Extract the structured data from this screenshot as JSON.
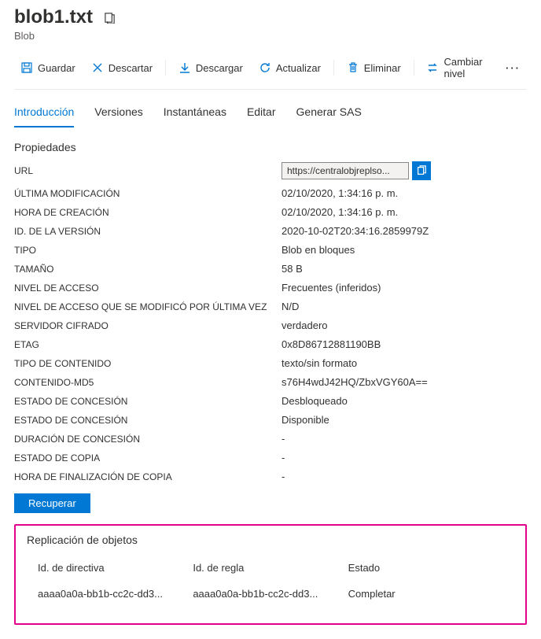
{
  "header": {
    "title": "blob1.txt",
    "subtitle": "Blob"
  },
  "toolbar": {
    "save": "Guardar",
    "discard": "Descartar",
    "download": "Descargar",
    "refresh": "Actualizar",
    "delete": "Eliminar",
    "change_tier": "Cambiar nivel"
  },
  "tabs": {
    "overview": "Introducción",
    "versions": "Versiones",
    "snapshots": "Instantáneas",
    "edit": "Editar",
    "generate_sas": "Generar SAS"
  },
  "section": {
    "properties": "Propiedades"
  },
  "props": {
    "url_label": "URL",
    "url_value": "https://centralobjreplso...",
    "last_modified_label": "ÚLTIMA MODIFICACIÓN",
    "last_modified_value": "02/10/2020, 1:34:16 p. m.",
    "created_label": "HORA DE CREACIÓN",
    "created_value": "02/10/2020, 1:34:16 p. m.",
    "version_id_label": "ID. DE LA VERSIÓN",
    "version_id_value": "2020-10-02T20:34:16.2859979Z",
    "type_label": "TIPO",
    "type_value": "Blob en bloques",
    "size_label": "TAMAÑO",
    "size_value": "58 B",
    "access_tier_label": "NIVEL DE ACCESO",
    "access_tier_value": "Frecuentes (inferidos)",
    "access_tier_modified_label": "NIVEL DE ACCESO QUE SE MODIFICÓ POR ÚLTIMA VEZ",
    "access_tier_modified_value": "N/D",
    "encrypted_label": "SERVIDOR CIFRADO",
    "encrypted_value": "verdadero",
    "etag_label": "ETAG",
    "etag_value": "0x8D86712881190BB",
    "content_type_label": "TIPO DE CONTENIDO",
    "content_type_value": "texto/sin formato",
    "md5_label": "CONTENIDO-MD5",
    "md5_value": "s76H4wdJ42HQ/ZbxVGY60A==",
    "lease_status_label": "ESTADO DE CONCESIÓN",
    "lease_status_value": "Desbloqueado",
    "lease_state_label": "ESTADO DE CONCESIÓN",
    "lease_state_value": "Disponible",
    "lease_duration_label": "DURACIÓN DE CONCESIÓN",
    "lease_duration_value": "-",
    "copy_status_label": "ESTADO DE COPIA",
    "copy_status_value": "-",
    "copy_completion_label": "HORA DE FINALIZACIÓN DE COPIA",
    "copy_completion_value": "-"
  },
  "buttons": {
    "undelete": "Recuperar"
  },
  "replication": {
    "title": "Replicación de objetos",
    "col_policy": "Id. de directiva",
    "col_rule": "Id. de regla",
    "col_status": "Estado",
    "rows": [
      {
        "policy": "aaaa0a0a-bb1b-cc2c-dd3...",
        "rule": "aaaa0a0a-bb1b-cc2c-dd3...",
        "status": "Completar"
      }
    ]
  }
}
